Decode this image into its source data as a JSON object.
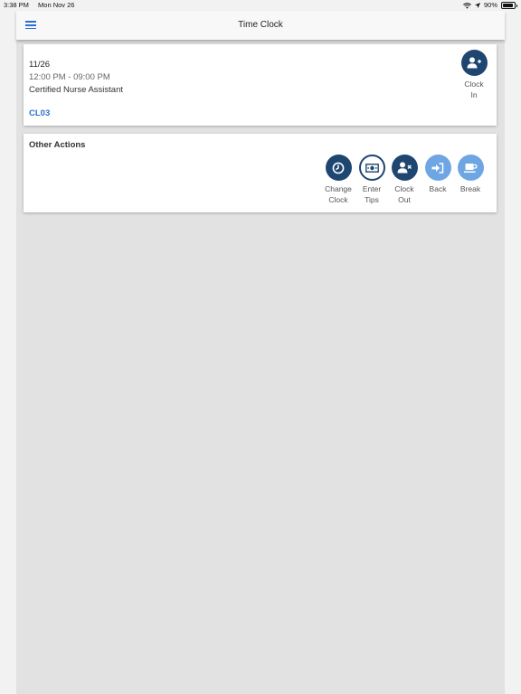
{
  "status_bar": {
    "time": "3:38 PM",
    "date": "Mon Nov 26",
    "battery": "90%"
  },
  "header": {
    "title": "Time Clock"
  },
  "shift": {
    "date": "11/26",
    "time_range": "12:00 PM - 09:00 PM",
    "role": "Certified Nurse Assistant",
    "code": "CL03",
    "clock_in_label_1": "Clock",
    "clock_in_label_2": "In"
  },
  "other_actions": {
    "title": "Other Actions",
    "actions": [
      {
        "line1": "Change",
        "line2": "Clock",
        "icon": "clock-icon"
      },
      {
        "line1": "Enter",
        "line2": "Tips",
        "icon": "money-icon"
      },
      {
        "line1": "Clock",
        "line2": "Out",
        "icon": "user-remove-icon"
      },
      {
        "line1": "Back",
        "line2": "",
        "icon": "sign-in-icon"
      },
      {
        "line1": "Break",
        "line2": "",
        "icon": "coffee-icon"
      }
    ]
  },
  "colors": {
    "accent": "#2c6fd1",
    "dark_button": "#1f4571",
    "light_button": "#6ea6e4"
  }
}
